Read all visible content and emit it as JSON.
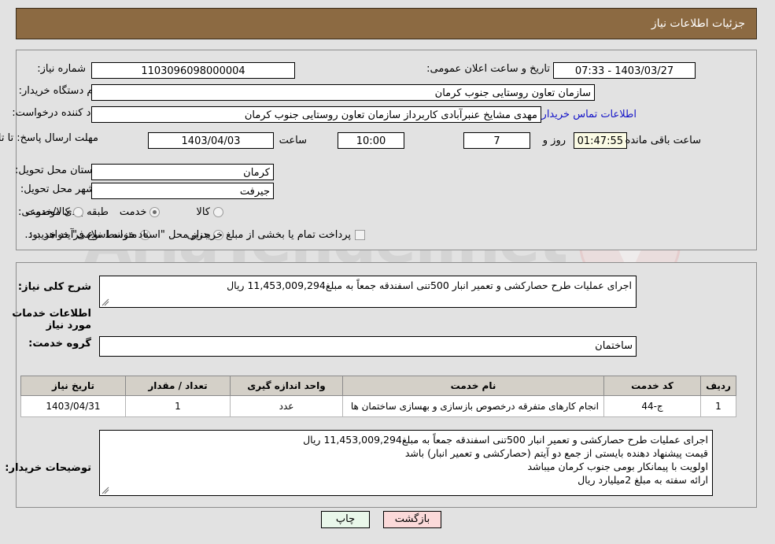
{
  "header": {
    "title": "جزئیات اطلاعات نیاز",
    "bg": "#8c6a42"
  },
  "form": {
    "need_number_label": "شماره نیاز:",
    "need_number_value": "1103096098000004",
    "announce_label": "تاریخ و ساعت اعلان عمومی:",
    "announce_value": "1403/03/27 - 07:33",
    "buyer_org_label": "نام دستگاه خریدار:",
    "buyer_org_value": "سازمان تعاون روستایی جنوب کرمان",
    "creator_label": "ایجاد کننده درخواست:",
    "creator_value": "مهدی مشایخ عنبرآبادی کاربرداز سازمان تعاون روستایی جنوب کرمان",
    "contact_link": "اطلاعات تماس خریدار",
    "deadline_label": "مهلت ارسال پاسخ: تا تاریخ:",
    "deadline_date": "1403/04/03",
    "hour_label": "ساعت",
    "deadline_time": "10:00",
    "days_remaining": "7",
    "days_label": "روز و",
    "countdown": "01:47:55",
    "hours_remaining_label": "ساعت باقی مانده",
    "province_label": "استان محل تحویل:",
    "province_value": "کرمان",
    "city_label": "شهر محل تحویل:",
    "city_value": "جیرفت",
    "category_label": "طبقه بندی موضوعی:",
    "category_options": [
      {
        "label": "کالا",
        "checked": false
      },
      {
        "label": "خدمت",
        "checked": true
      },
      {
        "label": "کالا/خدمت",
        "checked": false
      }
    ],
    "process_label": "نوع فرآیند خرید :",
    "process_options": [
      {
        "label": "جزیی",
        "checked": false
      },
      {
        "label": "متوسط",
        "checked": true
      }
    ],
    "treasury_checkbox_text": "پرداخت تمام یا بخشی از مبلغ خرید،از محل \"اسناد خزانه اسلامی\" خواهد بود.",
    "treasury_checked": false
  },
  "description": {
    "general_need_label": "شرح کلی نیاز:",
    "general_need_value": "اجرای عملیات طرح حصارکشی و تعمیر انبار 500تنی اسفندقه جمعاً به مبلغ11,453,009,294 ریال",
    "services_section_title": "اطلاعات خدمات مورد نیاز",
    "service_group_label": "گروه خدمت:",
    "service_group_value": "ساختمان"
  },
  "table": {
    "headers": [
      "ردیف",
      "کد خدمت",
      "نام خدمت",
      "واحد اندازه گیری",
      "تعداد / مقدار",
      "تاریخ نیاز"
    ],
    "rows": [
      {
        "row_no": "1",
        "service_code": "ج-44",
        "service_name": "انجام کارهای متفرقه درخصوص بازسازی و بهسازی ساختمان ها",
        "unit": "عدد",
        "quantity": "1",
        "need_date": "1403/04/31"
      }
    ]
  },
  "buyer_notes": {
    "label": "توضیحات خریدار:",
    "lines": [
      "اجرای عملیات طرح حصارکشی و تعمیر انبار 500تنی اسفندقه جمعاً به مبلغ11,453,009,294 ریال",
      "قیمت پیشنهاد دهنده بایستی از جمع دو آیتم (حصارکشی و تعمیر انبار) باشد",
      "اولویت با پیمانکار بومی جنوب کرمان میباشد",
      "ارائه سفته به مبلغ 2میلیارد ریال"
    ]
  },
  "buttons": {
    "print": "چاپ",
    "back": "بازگشت"
  },
  "watermark": {
    "text": "AriaTender.net"
  }
}
